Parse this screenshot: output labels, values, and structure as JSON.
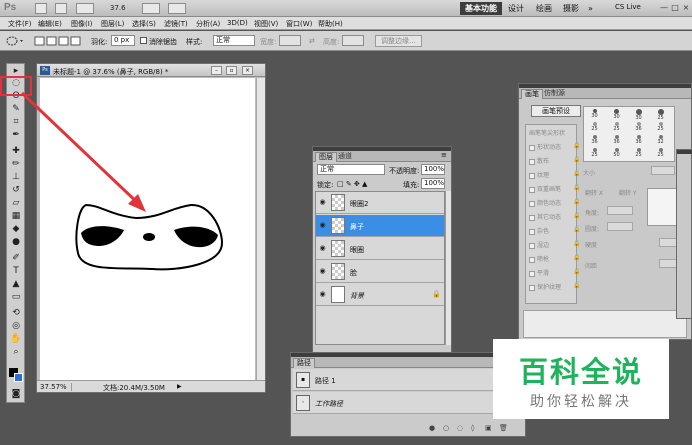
{
  "app": {
    "logo": "Ps",
    "zoom_value": "37.6",
    "workspaces": [
      "基本功能",
      "设计",
      "绘画",
      "摄影",
      "»"
    ],
    "cs_live": "CS Live",
    "window_controls": [
      "—",
      "□",
      "×"
    ]
  },
  "menu": [
    "文件(F)",
    "编辑(E)",
    "图像(I)",
    "图层(L)",
    "选择(S)",
    "滤镜(T)",
    "分析(A)",
    "3D(D)",
    "视图(V)",
    "窗口(W)",
    "帮助(H)"
  ],
  "options": {
    "feather_label": "羽化:",
    "feather_value": "0 px",
    "antialias_label": "消除锯齿",
    "style_label": "样式:",
    "style_value": "正常",
    "width_label": "宽度:",
    "height_label": "高度:",
    "refine_button": "调整边缘..."
  },
  "document": {
    "title": "未标题-1 @ 37.6% (鼻子, RGB/8) *",
    "zoom": "37.57%",
    "doc_info": "文档:20.4M/3.50M"
  },
  "layers_panel": {
    "tabs": [
      "图层",
      "通道"
    ],
    "blend_mode": "正常",
    "opacity_label": "不透明度:",
    "opacity_value": "100%",
    "lock_label": "锁定:",
    "fill_label": "填充:",
    "fill_value": "100%",
    "layers": [
      {
        "name": "眼圈2",
        "active": false
      },
      {
        "name": "鼻子",
        "active": true
      },
      {
        "name": "眼圈",
        "active": false
      },
      {
        "name": "脸",
        "active": false
      },
      {
        "name": "背景",
        "active": false,
        "locked": true
      }
    ]
  },
  "paths_panel": {
    "tab": "路径",
    "items": [
      "路径 1",
      "工作路径"
    ]
  },
  "brushes_panel": {
    "tabs": [
      "画笔",
      "仿制源"
    ],
    "preset_button": "画笔预设",
    "options": [
      "画笔笔尖形状",
      "形状动态",
      "散布",
      "纹理",
      "双重画笔",
      "颜色动态",
      "其它动态",
      "杂色",
      "湿边",
      "喷枪",
      "平滑",
      "保护纹理"
    ],
    "tip_sizes": [
      "30",
      "30",
      "30",
      "25",
      "25",
      "25",
      "36",
      "25",
      "36",
      "36",
      "36",
      "32",
      "25",
      "50",
      "25",
      "25"
    ],
    "size_label": "大小",
    "flip_x": "翻转 X",
    "flip_y": "翻转 Y",
    "angle_label": "角度:",
    "roundness_label": "圆度:",
    "hardness_label": "硬度",
    "spacing_label": "间距"
  },
  "watermark": {
    "main": "百科全说",
    "sub": "助你轻松解决"
  },
  "colors": {
    "accent": "#3a8ee6",
    "annotation": "#e2333b",
    "watermark_green": "#1fb45b"
  }
}
